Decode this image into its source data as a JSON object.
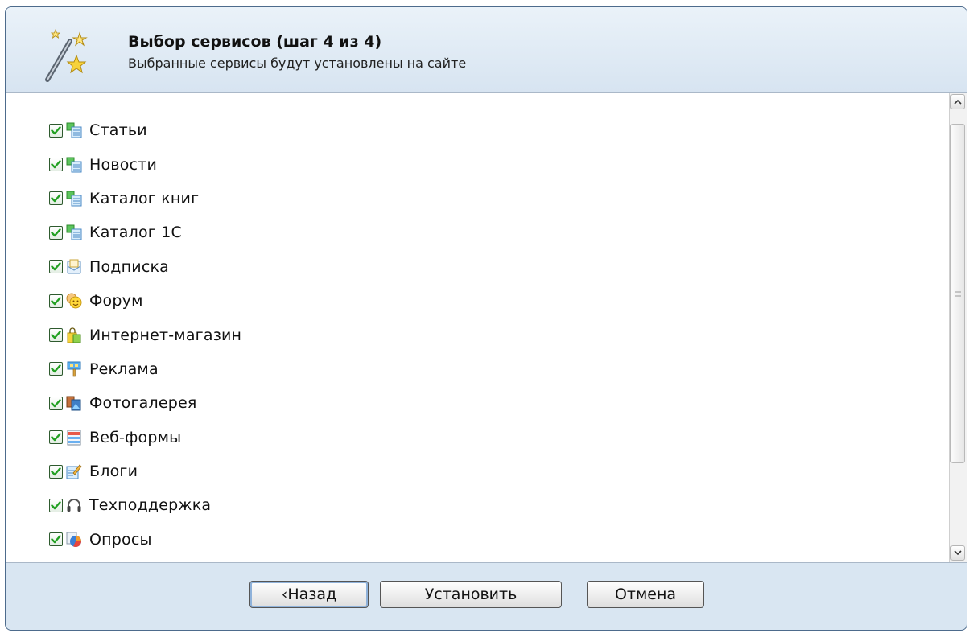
{
  "header": {
    "title": "Выбор сервисов (шаг 4 из 4)",
    "subtitle": "Выбранные сервисы будут установлены на сайте",
    "icon": "wand-stars-icon"
  },
  "services": [
    {
      "label": "Статьи",
      "checked": true,
      "icon": "pages-icon"
    },
    {
      "label": "Новости",
      "checked": true,
      "icon": "pages-icon"
    },
    {
      "label": "Каталог книг",
      "checked": true,
      "icon": "pages-icon"
    },
    {
      "label": "Каталог 1С",
      "checked": true,
      "icon": "pages-icon"
    },
    {
      "label": "Подписка",
      "checked": true,
      "icon": "envelope-icon"
    },
    {
      "label": "Форум",
      "checked": true,
      "icon": "smileys-icon"
    },
    {
      "label": "Интернет-магазин",
      "checked": true,
      "icon": "shopping-bag-icon"
    },
    {
      "label": "Реклама",
      "checked": true,
      "icon": "billboard-icon"
    },
    {
      "label": "Фотогалерея",
      "checked": true,
      "icon": "photos-icon"
    },
    {
      "label": "Веб-формы",
      "checked": true,
      "icon": "web-form-icon"
    },
    {
      "label": "Блоги",
      "checked": true,
      "icon": "blog-pencil-icon"
    },
    {
      "label": "Техподдержка",
      "checked": true,
      "icon": "headset-icon"
    },
    {
      "label": "Опросы",
      "checked": true,
      "icon": "pie-chart-icon"
    }
  ],
  "buttons": {
    "back": "‹Назад",
    "install": "Установить",
    "cancel": "Отмена"
  },
  "colors": {
    "frame_border": "#4d6b8c",
    "panel_background": "#d9e6f2",
    "checkbox_check": "#22a022"
  }
}
